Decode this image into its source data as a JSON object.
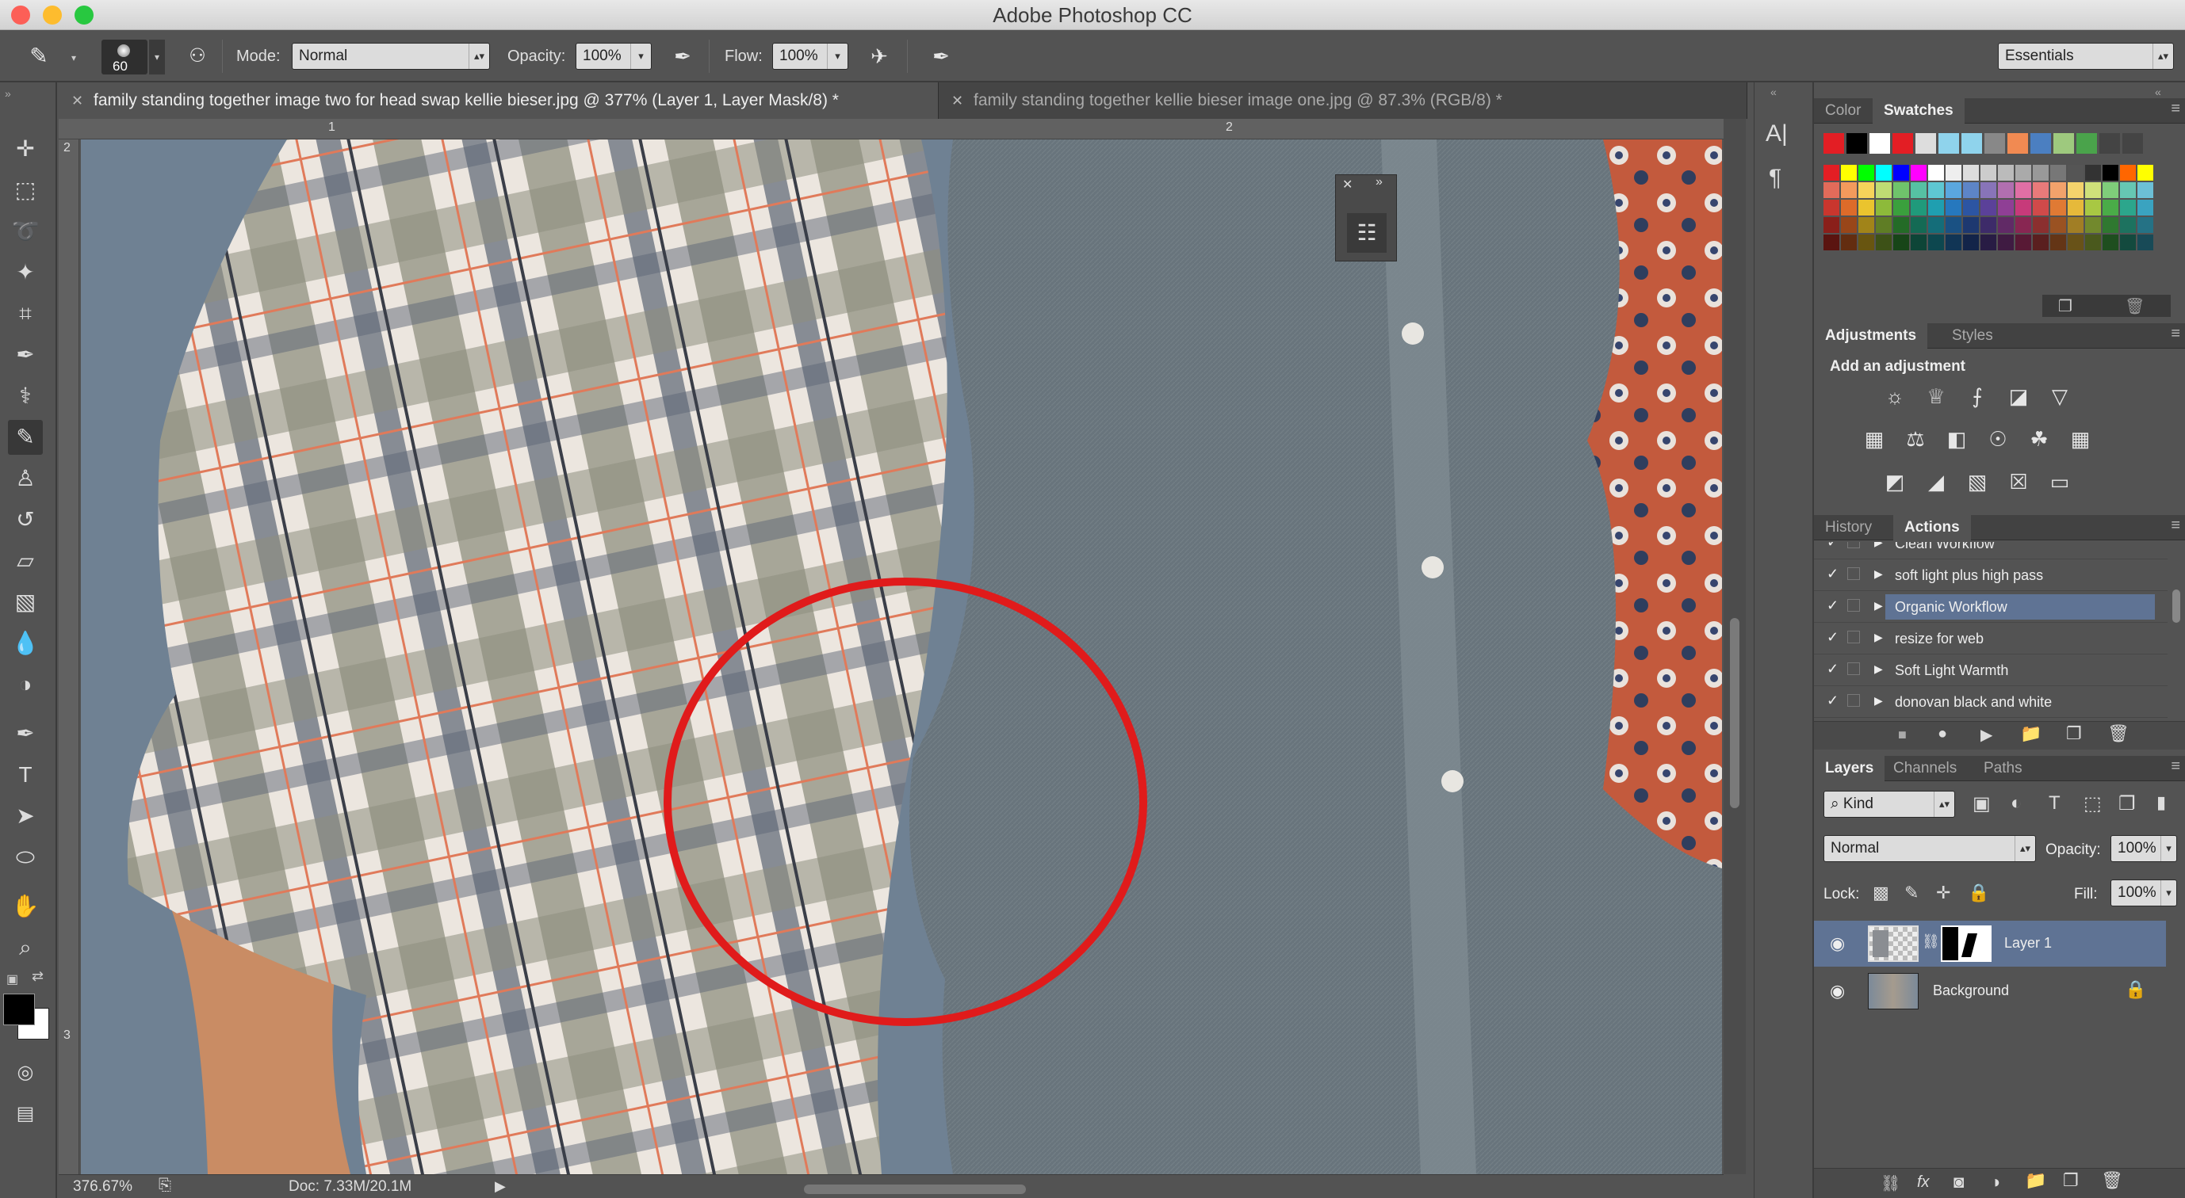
{
  "app": {
    "title": "Adobe Photoshop CC"
  },
  "options": {
    "brush_size": "60",
    "mode_label": "Mode:",
    "mode_value": "Normal",
    "opacity_label": "Opacity:",
    "opacity_value": "100%",
    "flow_label": "Flow:",
    "flow_value": "100%",
    "workspace": "Essentials"
  },
  "tabs": [
    {
      "label": "family standing together image two for head swap kellie bieser.jpg @ 377% (Layer 1, Layer Mask/8) *"
    },
    {
      "label": "family standing together kellie bieser image one.jpg @ 87.3% (RGB/8) *"
    }
  ],
  "rulers": {
    "h": [
      "1",
      "2"
    ],
    "v": [
      "2",
      "3"
    ]
  },
  "status": {
    "zoom": "376.67%",
    "doc": "Doc: 7.33M/20.1M"
  },
  "panels": {
    "color_tabs": [
      "Color",
      "Swatches"
    ],
    "adj_tabs": [
      "Adjustments",
      "Styles"
    ],
    "adj_heading": "Add an adjustment",
    "history_tabs": [
      "History",
      "Actions"
    ],
    "actions": [
      "Clean Workflow",
      "soft light plus high pass",
      "Organic Workflow",
      "resize for web",
      "Soft Light Warmth",
      "donovan black and white"
    ],
    "layers_tabs": [
      "Layers",
      "Channels",
      "Paths"
    ],
    "kind": "Kind",
    "blend": "Normal",
    "opacity_label": "Opacity:",
    "opacity_value": "100%",
    "lock_label": "Lock:",
    "fill_label": "Fill:",
    "fill_value": "100%",
    "layers": [
      {
        "name": "Layer 1"
      },
      {
        "name": "Background"
      }
    ]
  },
  "colors": {
    "accent": "#e01b1b",
    "selected_row": "#5f7394"
  }
}
